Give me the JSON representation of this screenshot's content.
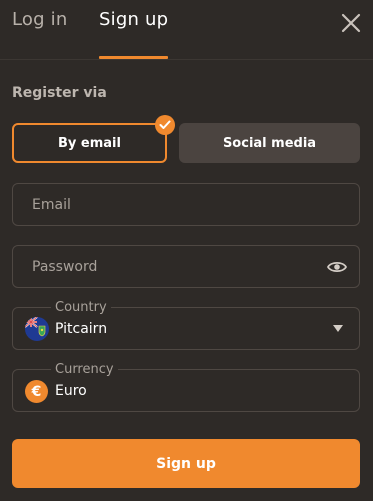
{
  "tabs": {
    "login_label": "Log in",
    "signup_label": "Sign up",
    "active": "signup"
  },
  "register": {
    "label": "Register via",
    "options": [
      "By email",
      "Social media"
    ],
    "selected": "By email"
  },
  "email": {
    "placeholder": "Email",
    "value": ""
  },
  "password": {
    "placeholder": "Password",
    "value": "",
    "toggle_icon": "eye-icon"
  },
  "country": {
    "label": "Country",
    "value": "Pitcairn",
    "icon": "pitcairn-flag-icon"
  },
  "currency": {
    "label": "Currency",
    "value": "Euro",
    "symbol": "€"
  },
  "submit_label": "Sign up",
  "icons": {
    "close": "close-icon",
    "check": "check-icon",
    "caret": "chevron-down-icon"
  },
  "colors": {
    "background": "#2e2a27",
    "accent": "#f0892e",
    "secondary_button": "#4b4440",
    "border": "#4f4843",
    "muted_text": "#a8a19a"
  }
}
